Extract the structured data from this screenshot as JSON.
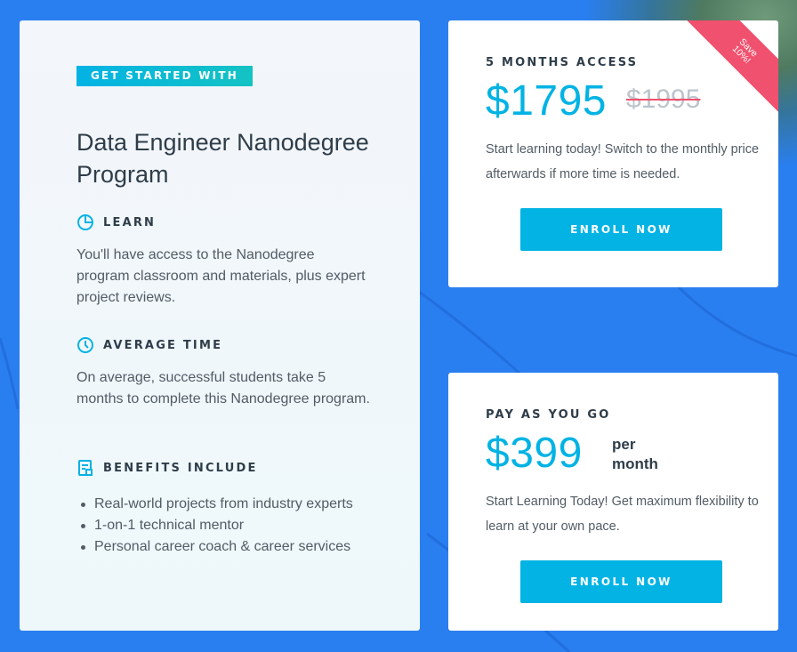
{
  "left": {
    "badge": "GET STARTED WITH",
    "title": "Data Engineer Nanodegree Program",
    "learn_heading": "LEARN",
    "learn_text": "You'll have access to the Nanodegree program classroom and materials, plus expert project reviews.",
    "time_heading": "AVERAGE TIME",
    "time_text": "On average, successful students take 5 months to complete this Nanodegree program.",
    "benefits_heading": "BENEFITS INCLUDE",
    "benefits": [
      "Real-world projects from industry experts",
      "1-on-1 technical mentor",
      "Personal career coach & career services"
    ]
  },
  "plan_1": {
    "title": "5 MONTHS ACCESS",
    "price": "$1795",
    "old_price": "$1995",
    "ribbon_line1": "Save",
    "ribbon_line2": "10%!",
    "description": "Start learning today! Switch to the monthly price afterwards if more time is needed.",
    "button": "ENROLL NOW"
  },
  "plan_2": {
    "title": "PAY AS YOU GO",
    "price": "$399",
    "per_line1": "per",
    "per_line2": "month",
    "description": "Start Learning Today! Get maximum flexibility to learn at your own pace.",
    "button": "ENROLL NOW"
  },
  "colors": {
    "background": "#2a7ff0",
    "accent": "#02b3e4",
    "sale": "#f0516e",
    "text": "#2e3d49"
  }
}
